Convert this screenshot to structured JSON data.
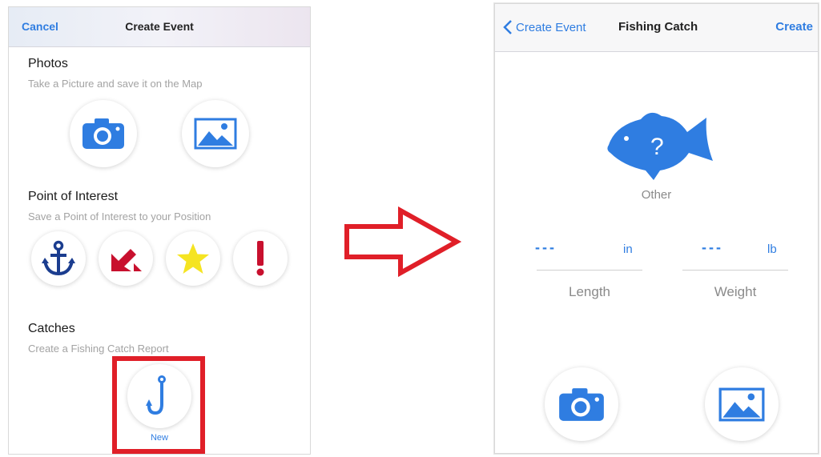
{
  "left_screen": {
    "navbar": {
      "cancel_label": "Cancel",
      "title": "Create Event"
    },
    "photos": {
      "title": "Photos",
      "subtitle": "Take a Picture and save it on the Map",
      "buttons": [
        {
          "icon": "camera-icon"
        },
        {
          "icon": "image-icon"
        }
      ]
    },
    "poi": {
      "title": "Point of Interest",
      "subtitle": "Save a Point of Interest to your Position",
      "buttons": [
        {
          "icon": "anchor-icon",
          "color": "#1b3d8f"
        },
        {
          "icon": "arrow-down-left-icon",
          "color": "#c8102e"
        },
        {
          "icon": "star-icon",
          "color": "#f5e422"
        },
        {
          "icon": "exclamation-icon",
          "color": "#c8102e"
        }
      ]
    },
    "catches": {
      "title": "Catches",
      "subtitle": "Create a Fishing Catch Report",
      "new_button": {
        "icon": "fish-hook-icon",
        "label": "New"
      }
    }
  },
  "arrow": {
    "icon": "right-arrow-icon",
    "color": "#e01f28"
  },
  "right_screen": {
    "navbar": {
      "back_label": "Create Event",
      "title": "Fishing Catch",
      "action_label": "Create"
    },
    "fish": {
      "icon": "fish-question-icon",
      "caption": "Other"
    },
    "length": {
      "value": "---",
      "unit": "in",
      "label": "Length"
    },
    "weight": {
      "value": "---",
      "unit": "lb",
      "label": "Weight"
    },
    "buttons": [
      {
        "icon": "camera-icon"
      },
      {
        "icon": "image-icon"
      }
    ]
  },
  "colors": {
    "accent": "#2f7de1",
    "highlight": "#e01f28",
    "secondary_text": "#a3a3a3"
  }
}
